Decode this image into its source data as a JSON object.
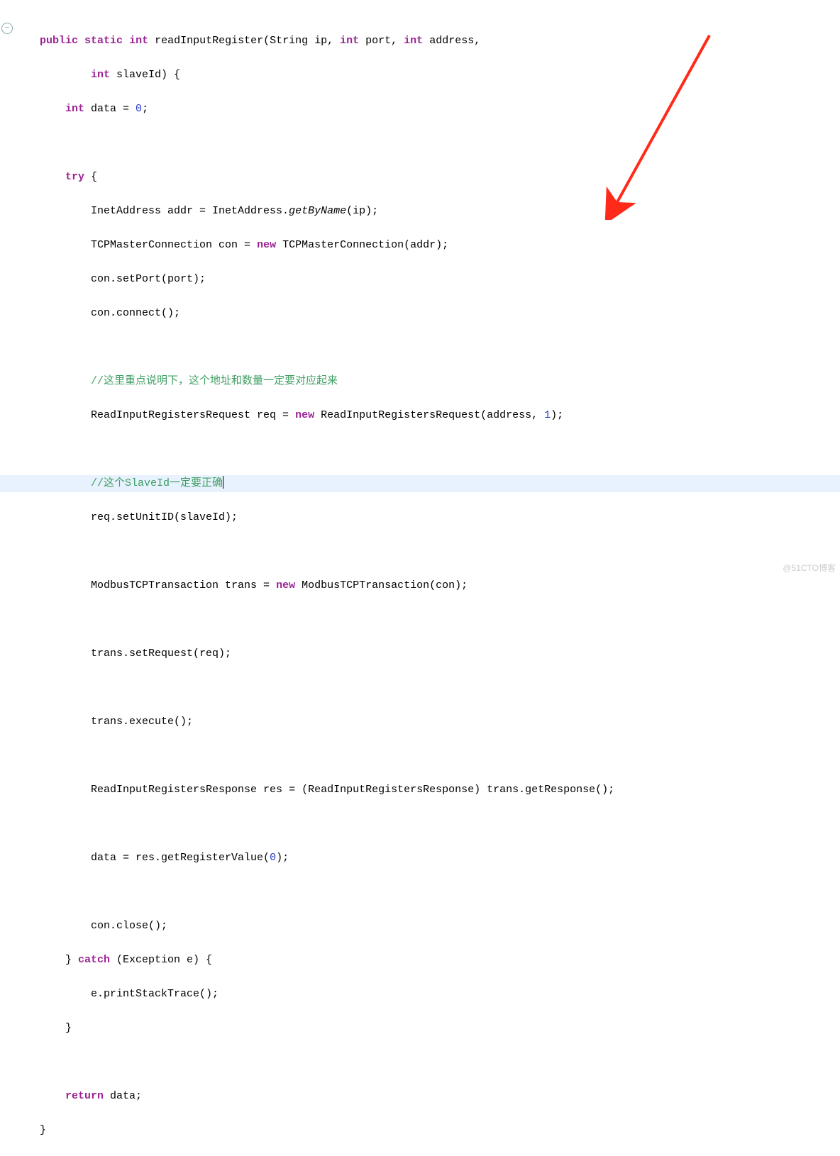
{
  "gutter": {
    "icon": "−"
  },
  "code": {
    "l1": "    public static int readInputRegister(String ip, int port, int address,",
    "l2": "            int slaveId) {",
    "l3": "        int data = 0;",
    "l5": "        try {",
    "l6": "            InetAddress addr = InetAddress.getByName(ip);",
    "l7": "            TCPMasterConnection con = new TCPMasterConnection(addr);",
    "l8": "            con.setPort(port);",
    "l9": "            con.connect();",
    "l11": "            //这里重点说明下，这个地址和数量一定要对应起来",
    "l12": "            ReadInputRegistersRequest req = new ReadInputRegistersRequest(address, 1);",
    "l14": "            //这个SlaveId一定要正确",
    "l15": "            req.setUnitID(slaveId);",
    "l17": "            ModbusTCPTransaction trans = new ModbusTCPTransaction(con);",
    "l19": "            trans.setRequest(req);",
    "l21": "            trans.execute();",
    "l23": "            ReadInputRegistersResponse res = (ReadInputRegistersResponse) trans.getResponse();",
    "l25": "            data = res.getRegisterValue(0);",
    "l27": "            con.close();",
    "l28": "        } catch (Exception e) {",
    "l29": "            e.printStackTrace();",
    "l30": "        }",
    "l32": "        return data;",
    "l33": "    }"
  },
  "tokens": {
    "public": "public",
    "static": "static",
    "int": "int",
    "try": "try",
    "new": "new",
    "catch": "catch",
    "return": "return",
    "getByName": "getByName",
    "readInputRegister": "readInputRegister",
    "TCPMasterConnection": "TCPMasterConnection",
    "ReadInputRegistersRequest": "ReadInputRegistersRequest",
    "ModbusTCPTransaction": "ModbusTCPTransaction",
    "one": "1",
    "zero": "0"
  },
  "watermark": "@51CTO博客"
}
